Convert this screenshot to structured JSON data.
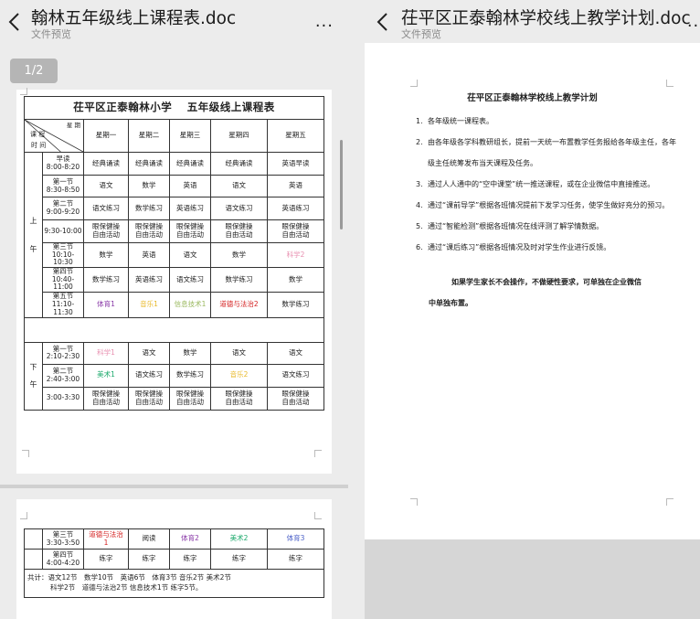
{
  "left": {
    "title": "翰林五年级线上课程表.doc",
    "subtitle": "文件预览",
    "more": "...",
    "page_indicator": "1/2",
    "table": {
      "title": "茌平区正泰翰林小学　 五年级线上课程表",
      "header_week": "星 期",
      "header_course": "课 程",
      "header_time": "时 间",
      "days": [
        "星期一",
        "星期二",
        "星期三",
        "星期四",
        "星期五"
      ],
      "am_label": [
        "上",
        "午"
      ],
      "pm_label": [
        "下",
        "午"
      ],
      "am_rows": [
        {
          "slot": [
            "早读",
            "8:00-8:20"
          ],
          "cells": [
            "经典诵读",
            "经典诵读",
            "经典诵读",
            "经典诵读",
            "英语早读"
          ]
        },
        {
          "slot": [
            "第一节",
            "8:30-8:50"
          ],
          "cells": [
            "语文",
            "数学",
            "英语",
            "语文",
            "英语"
          ]
        },
        {
          "slot": [
            "第二节",
            "9:00-9:20"
          ],
          "cells": [
            "语文练习",
            "数学练习",
            "英语练习",
            "语文练习",
            "英语练习"
          ]
        },
        {
          "slot": [
            "9:30-10:00"
          ],
          "cells": [
            "眼保健操\n自由活动",
            "眼保健操\n自由活动",
            "眼保健操\n自由活动",
            "眼保健操\n自由活动",
            "眼保健操\n自由活动"
          ]
        },
        {
          "slot": [
            "第三节",
            "10:10-10:30"
          ],
          "cells": [
            "数学",
            "英语",
            "语文",
            "数学",
            "科学2"
          ]
        },
        {
          "slot": [
            "第四节",
            "10:40-11:00"
          ],
          "cells": [
            "数学练习",
            "英语练习",
            "语文练习",
            "数学练习",
            "数学"
          ]
        },
        {
          "slot": [
            "第五节",
            "11:10-11:30"
          ],
          "cells": [
            "体育1",
            "音乐1",
            "信息技术1",
            "道德与法治2",
            "数学练习"
          ]
        }
      ],
      "pm_rows": [
        {
          "slot": [
            "第一节",
            "2:10-2:30"
          ],
          "cells": [
            "科学1",
            "语文",
            "数学",
            "语文",
            "语文"
          ]
        },
        {
          "slot": [
            "第二节",
            "2:40-3:00"
          ],
          "cells": [
            "美术1",
            "语文练习",
            "数学练习",
            "音乐2",
            "语文练习"
          ]
        },
        {
          "slot": [
            "3:00-3:30"
          ],
          "cells": [
            "眼保健操\n自由活动",
            "眼保健操\n自由活动",
            "眼保健操\n自由活动",
            "眼保健操\n自由活动",
            "眼保健操\n自由活动"
          ]
        }
      ]
    },
    "table2": {
      "rows": [
        {
          "slot": [
            "第三节",
            "3:30-3:50"
          ],
          "cells": [
            "道德与法治\n1",
            "阅读",
            "体育2",
            "美术2",
            "体育3"
          ]
        },
        {
          "slot": [
            "第四节",
            "4:00-4:20"
          ],
          "cells": [
            "练字",
            "练字",
            "练字",
            "练字",
            "练字"
          ]
        }
      ],
      "summary_line1": "共计：语文12节　数学10节　英语6节　体育3节 音乐2节 美术2节",
      "summary_line2": "科学2节　道德与法治2节 信息技术1节 练字5节。"
    },
    "colors": {
      "pink": "#e88fb0",
      "orange": "#e8b92a",
      "green": "#19a86a",
      "purple": "#8a3aa8",
      "red": "#d42020",
      "blue": "#4b60c8"
    }
  },
  "right": {
    "title": "茌平区正泰翰林学校线上教学计划.doc",
    "subtitle": "文件预览",
    "more": "...",
    "doc_title": "茌平区正泰翰林学校线上教学计划",
    "items": [
      {
        "num": "1.",
        "text": "各年级统一课程表。"
      },
      {
        "num": "2.",
        "text": "由各年级各学科教研组长，提前一天统一布置教学任务报给各年级主任，各年级主任统筹发布当天课程及任务。"
      },
      {
        "num": "3.",
        "text": "通过人人通中的“空中课堂”统一推送课程，或在企业微信中直接推送。"
      },
      {
        "num": "4.",
        "text": "通过“课前导学”根据各班情况提前下发学习任务，使学生做好充分的预习。"
      },
      {
        "num": "5.",
        "text": "通过“智能检测”根据各班情况在线评测了解学情数据。"
      },
      {
        "num": "6.",
        "text": "通过“课后练习”根据各班情况及时对学生作业进行反馈。"
      }
    ],
    "note_line1": "如果学生家长不会操作，不做硬性要求，可单独在企业微信",
    "note_line2": "中单独布置。"
  }
}
